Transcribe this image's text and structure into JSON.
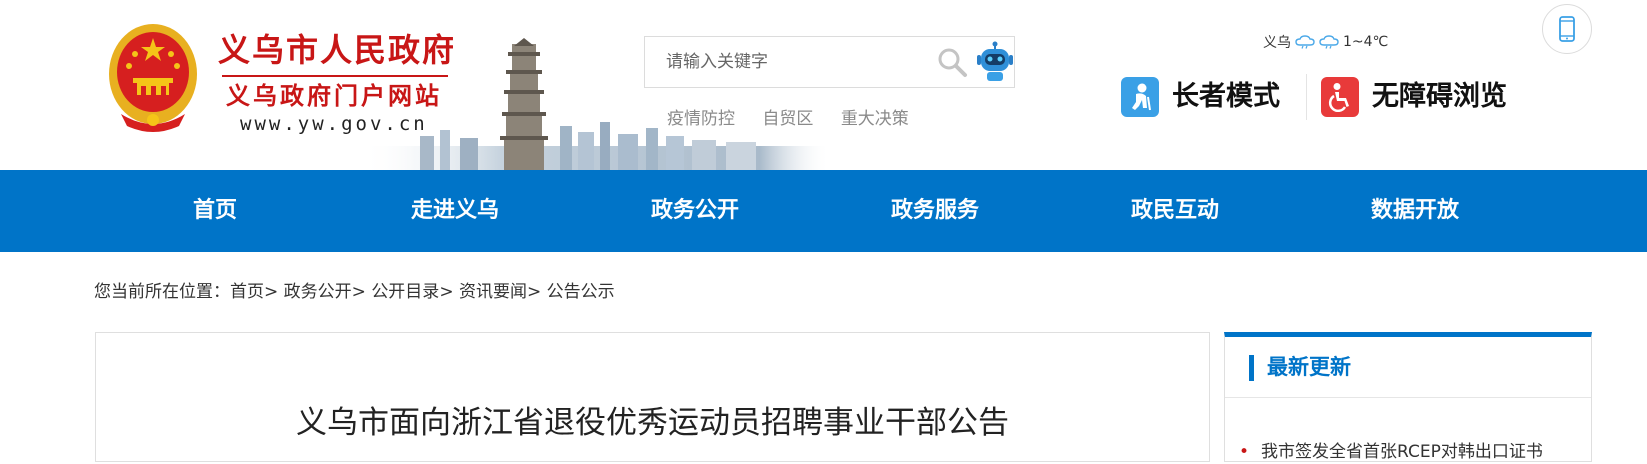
{
  "header": {
    "site_title": "义乌市人民政府",
    "site_subtitle": "义乌政府门户网站",
    "site_domain": "www.yw.gov.cn",
    "emblem_icon": "national-emblem-icon",
    "skyline_image": "pagoda-skyline-illustration"
  },
  "search": {
    "placeholder": "请输入关键字",
    "search_icon": "search-icon",
    "assistant_icon": "robot-icon"
  },
  "hot_links": [
    "疫情防控",
    "自贸区",
    "重大决策"
  ],
  "weather": {
    "city": "义乌",
    "icons": [
      "cloud-rain-icon",
      "cloud-rain-icon"
    ],
    "temperature": "1~4℃"
  },
  "mobile": {
    "icon": "mobile-phone-icon"
  },
  "modes": {
    "elder_label": "长者模式",
    "elder_icon": "elderly-person-icon",
    "accessible_label": "无障碍浏览",
    "accessible_icon": "wheelchair-icon"
  },
  "nav": {
    "items": [
      "首页",
      "走进义乌",
      "政务公开",
      "政务服务",
      "政民互动",
      "数据开放"
    ]
  },
  "breadcrumb": {
    "prefix": "您当前所在位置：",
    "items": [
      "首页",
      "政务公开",
      "公开目录",
      "资讯要闻",
      "公告公示"
    ],
    "separator": ">"
  },
  "article": {
    "title": "义乌市面向浙江省退役优秀运动员招聘事业干部公告"
  },
  "sidebar": {
    "title": "最新更新",
    "items": [
      "我市签发全省首张RCEP对韩出口证书"
    ]
  },
  "colors": {
    "brand_red": "#c81616",
    "nav_blue": "#0074c8",
    "elder_icon_bg": "#3aa0e6",
    "accessible_icon_bg": "#e83a3a"
  }
}
